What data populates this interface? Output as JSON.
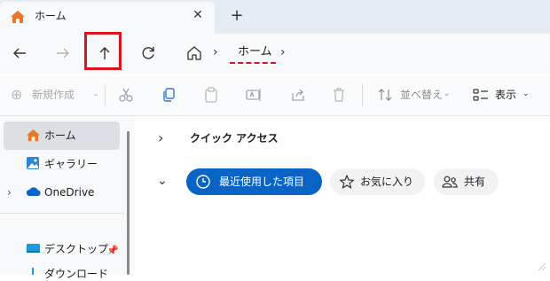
{
  "tab": {
    "title": "ホーム",
    "close_glyph": "✕",
    "new_tab_glyph": "+"
  },
  "nav": {
    "back_glyph": "←",
    "forward_glyph": "→",
    "up_glyph": "↑",
    "refresh_glyph": "↻"
  },
  "address": {
    "separator": "›",
    "crumb": "ホーム"
  },
  "toolbar": {
    "new_label": "新規作成",
    "new_icon": "⊕",
    "sort_label": "並べ替え",
    "view_label": "表示",
    "chevron": "⌄"
  },
  "sidebar": {
    "items": [
      {
        "label": "ホーム",
        "icon": "home-icon"
      },
      {
        "label": "ギャラリー",
        "icon": "gallery-icon"
      },
      {
        "label": "OneDrive",
        "icon": "cloud-icon",
        "expand_glyph": "›"
      },
      {
        "label": "デスクトップ",
        "icon": "desktop-icon",
        "pin_glyph": "📌"
      },
      {
        "label": "ダウンロード",
        "icon": "download-icon"
      }
    ]
  },
  "main": {
    "section_title": "クイック アクセス",
    "collapsed_glyph": "›",
    "expanded_glyph": "⌄",
    "filters": [
      {
        "label": "最近使用した項目",
        "icon": "clock-icon"
      },
      {
        "label": "お気に入り",
        "icon": "star-icon"
      },
      {
        "label": "共有",
        "icon": "people-icon"
      }
    ]
  },
  "colors": {
    "accent": "#0a64c5",
    "highlight": "#d9141e",
    "home_icon": "#e8762b",
    "onedrive": "#0a64c5"
  }
}
